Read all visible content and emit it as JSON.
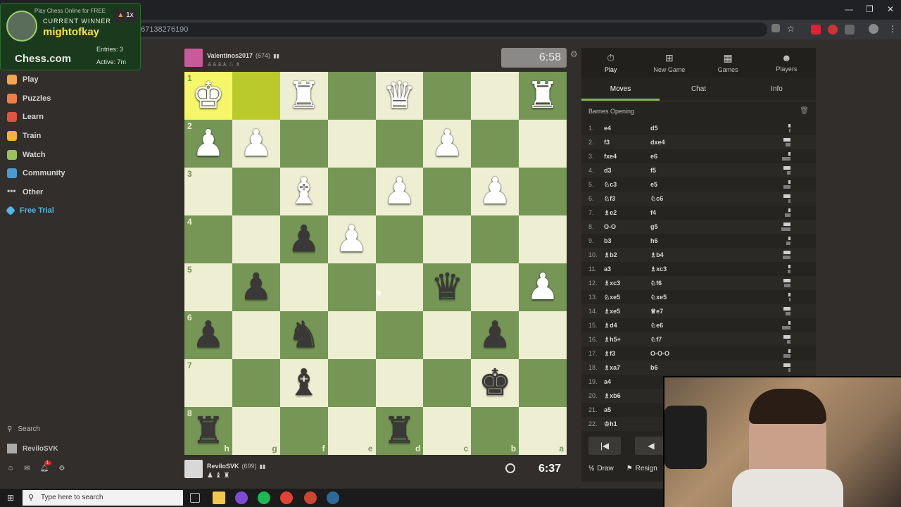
{
  "browser": {
    "url": "...m/game/167138276190"
  },
  "overlay": {
    "promo": "Play Chess Online for FREE",
    "current_winner_label": "CURRENT WINNER",
    "winner_name": "mightofkay",
    "streak": "1x",
    "logo": "Chess.com",
    "entries": "Entries: 3",
    "active": "Active: 7m"
  },
  "nav": {
    "items": [
      {
        "label": "Play",
        "icon": "play-icon",
        "color": "#f2a64a"
      },
      {
        "label": "Puzzles",
        "icon": "puzzle-icon",
        "color": "#f07f43"
      },
      {
        "label": "Learn",
        "icon": "learn-icon",
        "color": "#e0533f"
      },
      {
        "label": "Train",
        "icon": "train-icon",
        "color": "#f4b23a"
      },
      {
        "label": "Watch",
        "icon": "watch-icon",
        "color": "#9bc25d"
      },
      {
        "label": "Community",
        "icon": "community-icon",
        "color": "#4b9bd1"
      },
      {
        "label": "Other",
        "icon": "more-icon",
        "color": "#bfbfbf"
      },
      {
        "label": "Free Trial",
        "icon": "diamond-icon",
        "color": "#53b6e8"
      }
    ],
    "search_label": "Search",
    "user_label": "ReviloSVK",
    "notification_count": "1"
  },
  "game": {
    "top_player": {
      "name": "Valentinos2017",
      "rating": "(674)",
      "clock": "6:58"
    },
    "bottom_player": {
      "name": "ReviloSVK",
      "rating": "(699)",
      "clock": "6:37"
    },
    "ranks": [
      "1",
      "2",
      "3",
      "4",
      "5",
      "6",
      "7",
      "8"
    ],
    "files": [
      "h",
      "g",
      "f",
      "e",
      "d",
      "c",
      "b",
      "a"
    ],
    "board": [
      [
        "wK",
        "",
        "wR",
        "",
        "wQ",
        "",
        "",
        "wR"
      ],
      [
        "wP",
        "wP",
        "",
        "",
        "",
        "wP",
        "",
        ""
      ],
      [
        "",
        "",
        "wB",
        "",
        "wP",
        "",
        "wP",
        ""
      ],
      [
        "",
        "",
        "bP",
        "wP",
        "",
        "",
        "",
        ""
      ],
      [
        "",
        "bP",
        "",
        "",
        "",
        "bQ",
        "",
        "wP"
      ],
      [
        "bP",
        "",
        "bN",
        "",
        "",
        "",
        "bP",
        ""
      ],
      [
        "",
        "",
        "bB",
        "",
        "",
        "",
        "bK",
        ""
      ],
      [
        "bR",
        "",
        "",
        "",
        "bR",
        "",
        "",
        ""
      ]
    ],
    "highlight": [
      [
        0,
        0
      ],
      [
        0,
        1
      ]
    ]
  },
  "panel": {
    "tabs": [
      {
        "label": "Play",
        "icon": "stopwatch-icon"
      },
      {
        "label": "New Game",
        "icon": "plus-icon"
      },
      {
        "label": "Games",
        "icon": "games-icon"
      },
      {
        "label": "Players",
        "icon": "players-icon"
      }
    ],
    "subtabs": [
      "Moves",
      "Chat",
      "Info"
    ],
    "opening": "Barnes Opening",
    "moves": [
      {
        "n": "1.",
        "w": "e4",
        "b": "d5"
      },
      {
        "n": "2.",
        "w": "f3",
        "b": "dxe4"
      },
      {
        "n": "3.",
        "w": "fxe4",
        "b": "e6"
      },
      {
        "n": "4.",
        "w": "d3",
        "b": "f5"
      },
      {
        "n": "5.",
        "w": "♘c3",
        "b": "e5"
      },
      {
        "n": "6.",
        "w": "♘f3",
        "b": "♘c6"
      },
      {
        "n": "7.",
        "w": "♗e2",
        "b": "f4"
      },
      {
        "n": "8.",
        "w": "O-O",
        "b": "g5"
      },
      {
        "n": "9.",
        "w": "b3",
        "b": "h6"
      },
      {
        "n": "10.",
        "w": "♗b2",
        "b": "♗b4"
      },
      {
        "n": "11.",
        "w": "a3",
        "b": "♗xc3"
      },
      {
        "n": "12.",
        "w": "♗xc3",
        "b": "♘f6"
      },
      {
        "n": "13.",
        "w": "♘xe5",
        "b": "♘xe5"
      },
      {
        "n": "14.",
        "w": "♗xe5",
        "b": "♕e7"
      },
      {
        "n": "15.",
        "w": "♗d4",
        "b": "♘e6"
      },
      {
        "n": "16.",
        "w": "♗h5+",
        "b": "♘f7"
      },
      {
        "n": "17.",
        "w": "♗f3",
        "b": "O-O-O"
      },
      {
        "n": "18.",
        "w": "♗xa7",
        "b": "b6"
      },
      {
        "n": "19.",
        "w": "a4",
        "b": ""
      },
      {
        "n": "20.",
        "w": "♗xb6",
        "b": ""
      },
      {
        "n": "21.",
        "w": "a5",
        "b": ""
      },
      {
        "n": "22.",
        "w": "♔h1",
        "b": ""
      }
    ],
    "draw_label": "Draw",
    "resign_label": "Resign",
    "half_label": "½"
  },
  "taskbar": {
    "search_placeholder": "Type here to search"
  }
}
